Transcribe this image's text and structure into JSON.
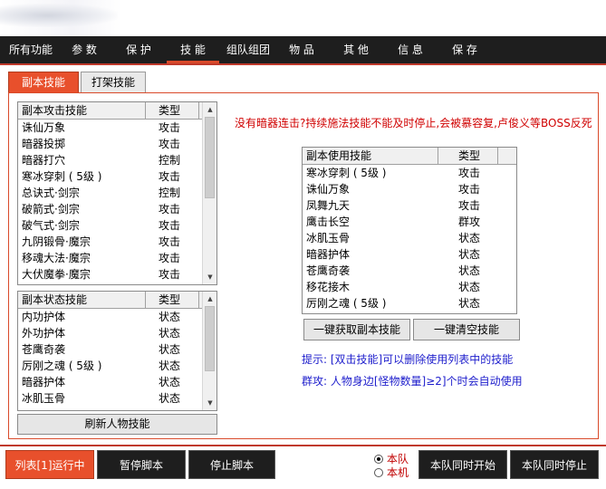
{
  "nav": [
    {
      "label": "所有功能",
      "active": false
    },
    {
      "label": "参 数",
      "active": false
    },
    {
      "label": "保 护",
      "active": false
    },
    {
      "label": "技 能",
      "active": true
    },
    {
      "label": "组队组团",
      "active": false
    },
    {
      "label": "物 品",
      "active": false
    },
    {
      "label": "其 他",
      "active": false
    },
    {
      "label": "信 息",
      "active": false
    },
    {
      "label": "保 存",
      "active": false
    }
  ],
  "subtabs": [
    {
      "label": "副本技能",
      "active": true
    },
    {
      "label": "打架技能",
      "active": false
    }
  ],
  "attack_list": {
    "headers": [
      "副本攻击技能",
      "类型"
    ],
    "rows": [
      [
        "诛仙万象",
        "攻击"
      ],
      [
        "暗器投掷",
        "攻击"
      ],
      [
        "暗器打穴",
        "控制"
      ],
      [
        "寒冰穿刺 ( 5级 )",
        "攻击"
      ],
      [
        "总诀式·剑宗",
        "控制"
      ],
      [
        "破箭式·剑宗",
        "攻击"
      ],
      [
        "破气式·剑宗",
        "攻击"
      ],
      [
        "九阴锻骨·魔宗",
        "攻击"
      ],
      [
        "移魂大法·魔宗",
        "攻击"
      ],
      [
        "大伏魔拳·魔宗",
        "攻击"
      ]
    ]
  },
  "status_list": {
    "headers": [
      "副本状态技能",
      "类型"
    ],
    "rows": [
      [
        "内功护体",
        "状态"
      ],
      [
        "外功护体",
        "状态"
      ],
      [
        "苍鹰奇袭",
        "状态"
      ],
      [
        "厉刚之魂 ( 5级 )",
        "状态"
      ],
      [
        "暗器护体",
        "状态"
      ],
      [
        "冰肌玉骨",
        "状态"
      ]
    ]
  },
  "refresh_button": "刷新人物技能",
  "warning_text": "没有暗器连击?持续施法技能不能及时停止,会被慕容复,卢俊义等BOSS反死",
  "use_list": {
    "headers": [
      "副本使用技能",
      "类型"
    ],
    "rows": [
      [
        "寒冰穿刺 ( 5级 )",
        "攻击"
      ],
      [
        "诛仙万象",
        "攻击"
      ],
      [
        "凤舞九天",
        "攻击"
      ],
      [
        "鹰击长空",
        "群攻"
      ],
      [
        "冰肌玉骨",
        "状态"
      ],
      [
        "暗器护体",
        "状态"
      ],
      [
        "苍鹰奇袭",
        "状态"
      ],
      [
        "移花接木",
        "状态"
      ],
      [
        "厉刚之魂 ( 5级 )",
        "状态"
      ]
    ]
  },
  "get_button": "一键获取副本技能",
  "clear_button": "一键清空技能",
  "hint1": "提示: [双击技能]可以删除使用列表中的技能",
  "hint2": "群攻: 人物身边[怪物数量]≥2]个时会自动使用",
  "bottom": {
    "run": "列表[1]运行中",
    "pause": "暂停脚本",
    "stop": "停止脚本",
    "radio1": "本队",
    "radio2": "本机",
    "team_start": "本队同时开始",
    "team_stop": "本队同时停止"
  },
  "colors": {
    "accent": "#e8502c",
    "nav_bg": "#1e1e1e",
    "warning": "#d00000",
    "hint": "#1d1dcc"
  }
}
